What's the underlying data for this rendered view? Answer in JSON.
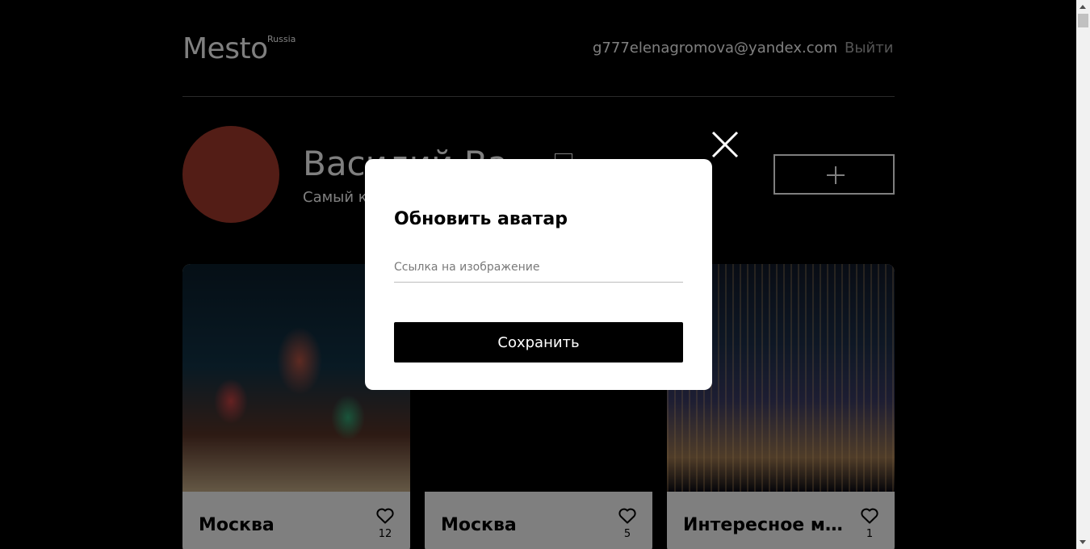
{
  "header": {
    "logo": "Mesto",
    "logo_sup": "Russia",
    "email": "g777elenagromova@yandex.com",
    "logout": "Выйти"
  },
  "profile": {
    "name": "Василий Ва",
    "about": "Самый к",
    "avatar_color": "#a63a2c"
  },
  "cards": [
    {
      "title": "Москва",
      "likes": "12"
    },
    {
      "title": "Москва",
      "likes": "5"
    },
    {
      "title": "Интересное мес…",
      "likes": "1"
    }
  ],
  "popup": {
    "title": "Обновить аватар",
    "input_placeholder": "Ссылка на изображение",
    "save_label": "Сохранить",
    "close_icon": "close-icon"
  },
  "colors": {
    "background": "#000000",
    "popup_background": "#ffffff",
    "button": "#000000",
    "overlay": "rgba(0,0,0,0.5)"
  }
}
